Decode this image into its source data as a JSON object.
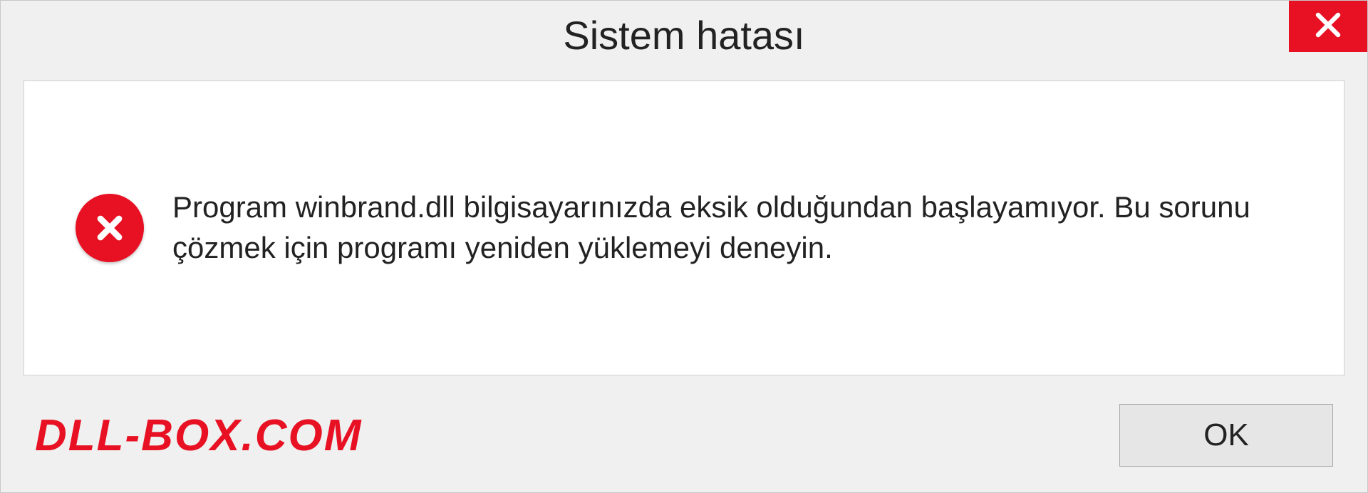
{
  "dialog": {
    "title": "Sistem hatası",
    "message": "Program winbrand.dll bilgisayarınızda eksik olduğundan başlayamıyor. Bu sorunu çözmek için programı yeniden yüklemeyi deneyin.",
    "ok_label": "OK"
  },
  "watermark": "DLL-BOX.COM",
  "colors": {
    "accent_red": "#e81123",
    "background": "#f0f0f0",
    "content_bg": "#ffffff"
  }
}
